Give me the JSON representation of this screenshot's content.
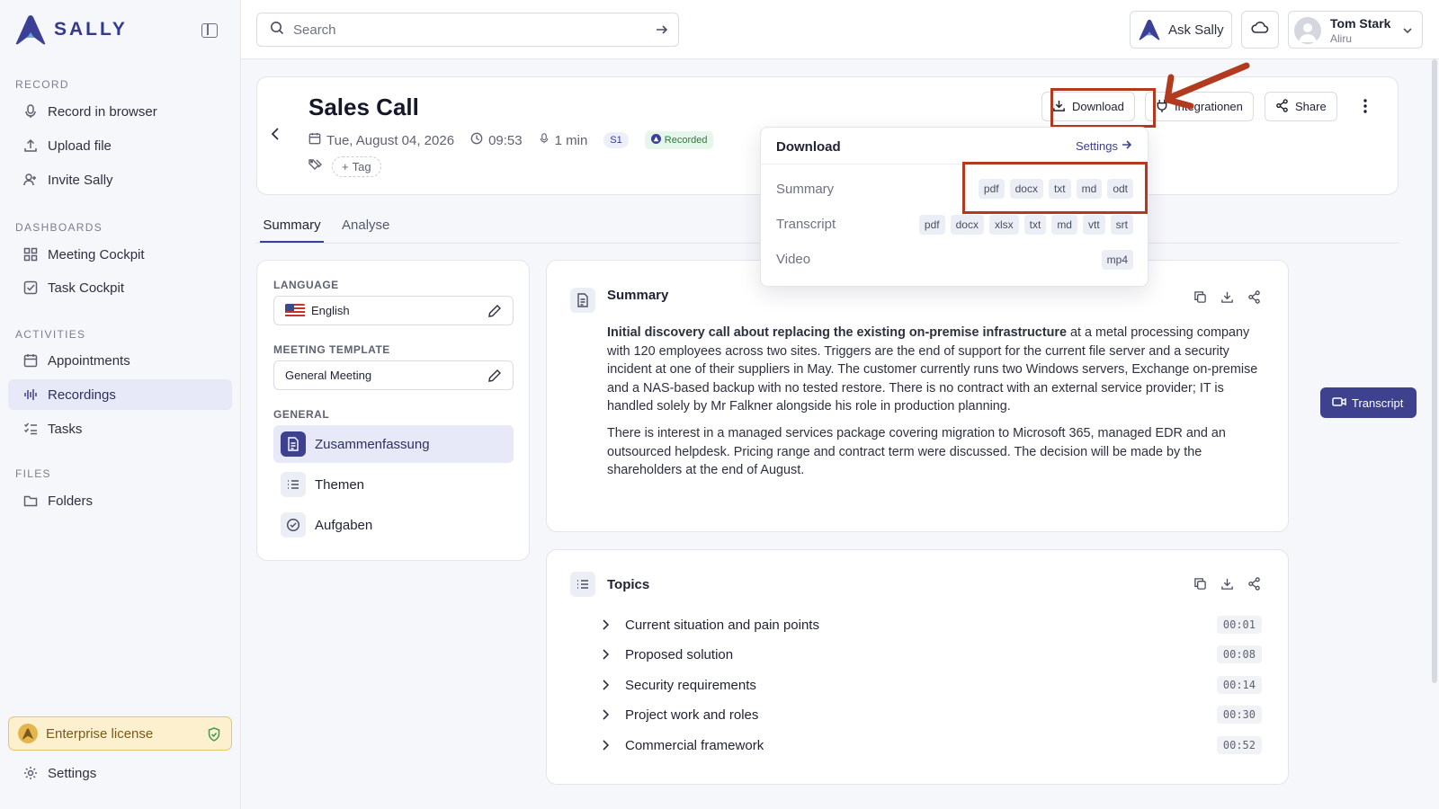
{
  "brand": {
    "name": "SALLY"
  },
  "sidebar": {
    "sections": [
      {
        "label": "RECORD",
        "items": [
          {
            "label": "Record in browser",
            "icon": "microphone-icon"
          },
          {
            "label": "Upload file",
            "icon": "upload-icon"
          },
          {
            "label": "Invite Sally",
            "icon": "user-plus-icon"
          }
        ]
      },
      {
        "label": "DASHBOARDS",
        "items": [
          {
            "label": "Meeting Cockpit",
            "icon": "grid-icon"
          },
          {
            "label": "Task Cockpit",
            "icon": "checkbox-icon"
          }
        ]
      },
      {
        "label": "ACTIVITIES",
        "items": [
          {
            "label": "Appointments",
            "icon": "calendar-icon"
          },
          {
            "label": "Recordings",
            "icon": "waveform-icon",
            "active": true
          },
          {
            "label": "Tasks",
            "icon": "checklist-icon"
          }
        ]
      },
      {
        "label": "FILES",
        "items": [
          {
            "label": "Folders",
            "icon": "folder-icon"
          }
        ]
      }
    ],
    "license": "Enterprise license",
    "settings": "Settings"
  },
  "topbar": {
    "search_placeholder": "Search",
    "ask_label": "Ask Sally",
    "user": {
      "name": "Tom Stark",
      "org": "Aliru"
    }
  },
  "meeting": {
    "title": "Sales Call",
    "date": "Tue, August 04, 2026",
    "time": "09:53",
    "duration": "1 min",
    "speaker_chip": "S1",
    "status": "Recorded",
    "tag_label": "Tag",
    "actions": {
      "download": "Download",
      "integrations": "Integrationen",
      "share": "Share"
    }
  },
  "tabs": [
    "Summary",
    "Analyse"
  ],
  "settings_panel": {
    "language_label": "LANGUAGE",
    "language_value": "English",
    "template_label": "MEETING TEMPLATE",
    "template_value": "General Meeting",
    "general_label": "GENERAL",
    "general_items": [
      "Zusammenfassung",
      "Themen",
      "Aufgaben"
    ]
  },
  "summary": {
    "title": "Summary",
    "lead_bold": "Initial discovery call about replacing the existing on-premise infrastructure",
    "lead_rest": " at a metal processing company with 120 employees across two sites. Triggers are the end of support for the current file server and a security incident at one of their suppliers in May. The customer currently runs two Windows servers, Exchange on-premise and a NAS-based backup with no tested restore. There is no contract with an external service provider; IT is handled solely by Mr Falkner alongside his role in production planning.",
    "paragraph2": "There is interest in a managed services package covering migration to Microsoft 365, managed EDR and an outsourced helpdesk. Pricing range and contract term were discussed. The decision will be made by the shareholders at the end of August."
  },
  "topics": {
    "title": "Topics",
    "items": [
      {
        "label": "Current situation and pain points",
        "time": "00:01"
      },
      {
        "label": "Proposed solution",
        "time": "00:08"
      },
      {
        "label": "Security requirements",
        "time": "00:14"
      },
      {
        "label": "Project work and roles",
        "time": "00:30"
      },
      {
        "label": "Commercial framework",
        "time": "00:52"
      }
    ]
  },
  "download_menu": {
    "title": "Download",
    "settings_link": "Settings",
    "rows": [
      {
        "label": "Summary",
        "formats": [
          "pdf",
          "docx",
          "txt",
          "md",
          "odt"
        ]
      },
      {
        "label": "Transcript",
        "formats": [
          "pdf",
          "docx",
          "xlsx",
          "txt",
          "md",
          "vtt",
          "srt"
        ]
      },
      {
        "label": "Video",
        "formats": [
          "mp4"
        ]
      }
    ]
  },
  "transcript_button": "Transcript",
  "colors": {
    "accent": "#3d418e",
    "annotation": "#b23a1e",
    "recorded": "#2c7a3f",
    "license": "#fcf0cf"
  }
}
